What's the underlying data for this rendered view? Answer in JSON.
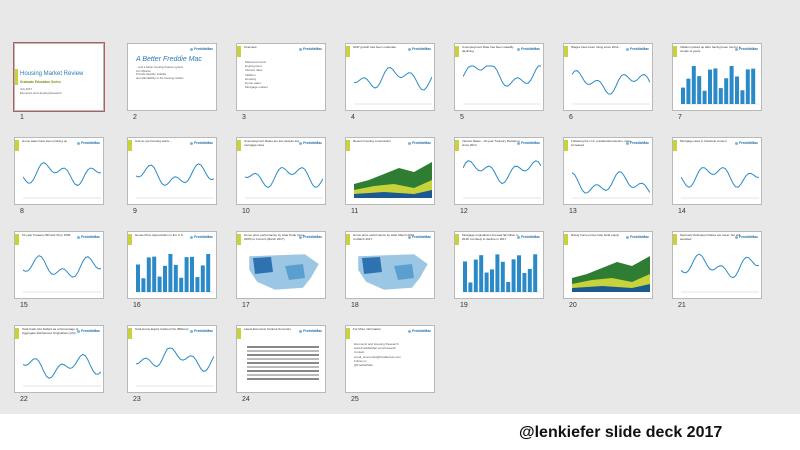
{
  "caption": "@lenkiefer slide deck 2017",
  "logo_text": "FreddieMac",
  "slides": [
    {
      "num": "1",
      "kind": "title",
      "title": "Housing Market Review",
      "subtitle": "Graduate Education Series",
      "meta": [
        "July 2017",
        "Economic and Housing Research"
      ]
    },
    {
      "num": "2",
      "kind": "s2",
      "title": "A Better Freddie Mac",
      "subtitle": "...and a better housing finance system",
      "lines": [
        "Our Mission",
        "Provide liquidity, stability",
        "and affordability to the housing market"
      ]
    },
    {
      "num": "3",
      "kind": "bullets",
      "title": "Overview",
      "lines": [
        "Macroeconomic",
        "Employment",
        "Interest rates",
        "Inflation",
        "Housing",
        "Home sales",
        "Mortgage market"
      ]
    },
    {
      "num": "4",
      "kind": "line",
      "title": "GDP growth has been moderate"
    },
    {
      "num": "5",
      "kind": "line",
      "title": "Unemployment Rate has been steadily declining"
    },
    {
      "num": "6",
      "kind": "line",
      "title": "Wages have been rising since 2014..."
    },
    {
      "num": "7",
      "kind": "bars",
      "title": "Inflation picked up after having been low for a couple of years"
    },
    {
      "num": "8",
      "kind": "line",
      "title": "Home sales have been picking up"
    },
    {
      "num": "9",
      "kind": "line",
      "title": "And so are housing starts..."
    },
    {
      "num": "10",
      "kind": "line",
      "title": "Unemployment Rates are low despite low mortgage rates"
    },
    {
      "num": "11",
      "kind": "area",
      "title": "Recent housing construction"
    },
    {
      "num": "12",
      "kind": "line",
      "title": "Interest Rates - 10-year Treasury Declaring since 2014"
    },
    {
      "num": "13",
      "kind": "line",
      "title": "Following the U.S. presidential election, rates increased"
    },
    {
      "num": "14",
      "kind": "line",
      "title": "Mortgage rates in historical context"
    },
    {
      "num": "15",
      "kind": "line",
      "title": "10-year Treasury Bill and 30-yr FRM"
    },
    {
      "num": "16",
      "kind": "bars",
      "title": "House Price Appreciation in the U.S."
    },
    {
      "num": "17",
      "kind": "map",
      "title": "Home price performance by state Peak (June 2006) to Current (March 2017)"
    },
    {
      "num": "18",
      "kind": "map",
      "title": "Home price performance by state March 2016 to March 2017"
    },
    {
      "num": "19",
      "kind": "bars",
      "title": "Mortgage originations forecast $2 trillion in 2018, but likely to decline in 2017"
    },
    {
      "num": "20",
      "kind": "area",
      "title": "Rising home prices help build equity"
    },
    {
      "num": "21",
      "kind": "line",
      "title": "Seriously Delinquent Rates are lower, but still elevated"
    },
    {
      "num": "22",
      "kind": "line",
      "title": "Total Cash-Out Dollars as a Percentage of Aggregate Refinanced Originations (Q4)"
    },
    {
      "num": "23",
      "kind": "line",
      "title": "Total Home Equity Cashed Out (Billions)"
    },
    {
      "num": "24",
      "kind": "table",
      "title": "Latest Economic Outlook Summary"
    },
    {
      "num": "25",
      "kind": "contact",
      "title": "For More Information",
      "lines": [
        "Economic and Housing Research",
        "www.FreddieMac.com/research",
        "Contact",
        "email_economist@freddiemac.com",
        "Follow us",
        "@FreddieMac"
      ]
    }
  ]
}
